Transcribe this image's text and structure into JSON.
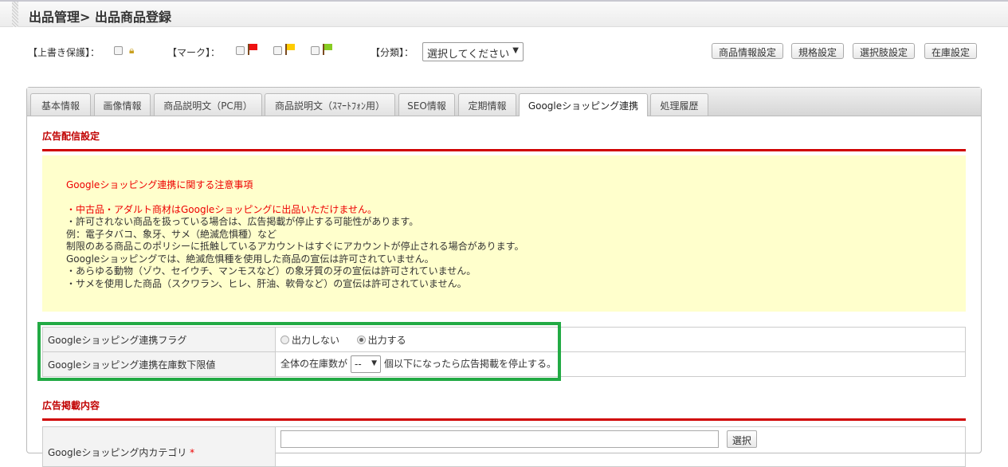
{
  "header": {
    "title": "出品管理> 出品商品登録"
  },
  "options": {
    "overwrite_label": "【上書き保護】：",
    "mark_label": "【マーク】：",
    "category_label": "【分類】：",
    "category_value": "選択してください",
    "flag_colors": [
      "#ee1111",
      "#ffcc00",
      "#88cc22"
    ]
  },
  "toolbar": [
    "商品情報設定",
    "規格設定",
    "選択肢設定",
    "在庫設定"
  ],
  "tabs": [
    "基本情報",
    "画像情報",
    "商品説明文（PC用）",
    "商品説明文（ｽﾏｰﾄﾌｫﾝ用）",
    "SEO情報",
    "定期情報",
    "Googleショッピング連携",
    "処理履歴"
  ],
  "section1": "広告配信設定",
  "notice": {
    "title": "Googleショッピング連携に関する注意事項",
    "lines_red": [
      "・中古品・アダルト商材はGoogleショッピングに出品いただけません。"
    ],
    "lines": [
      "・許可されない商品を扱っている場合は、広告掲載が停止する可能性があります。",
      "例：電子タバコ、象牙、サメ（絶滅危惧種）など",
      "制限のある商品このポリシーに抵触しているアカウントはすぐにアカウントが停止される場合があります。",
      "Googleショッピングでは、絶滅危惧種を使用した商品の宣伝は許可されていません。",
      "・あらゆる動物（ゾウ、セイウチ、マンモスなど）の象牙質の牙の宣伝は許可されていません。",
      "・サメを使用した商品（スクワラン、ヒレ、肝油、軟骨など）の宣伝は許可されていません。"
    ]
  },
  "form1": {
    "flag_label": "Googleショッピング連携フラグ",
    "opt_off": "出力しない",
    "opt_on": "出力する",
    "stock_label": "Googleショッピング連携在庫数下限値",
    "stock_prefix": "全体の在庫数が",
    "stock_value": "--",
    "stock_suffix": "個以下になったら広告掲載を停止する。"
  },
  "section2": "広告掲載内容",
  "form2": {
    "category_label": "Googleショッピング内カテゴリ",
    "required": "*",
    "select_button": "選択"
  }
}
